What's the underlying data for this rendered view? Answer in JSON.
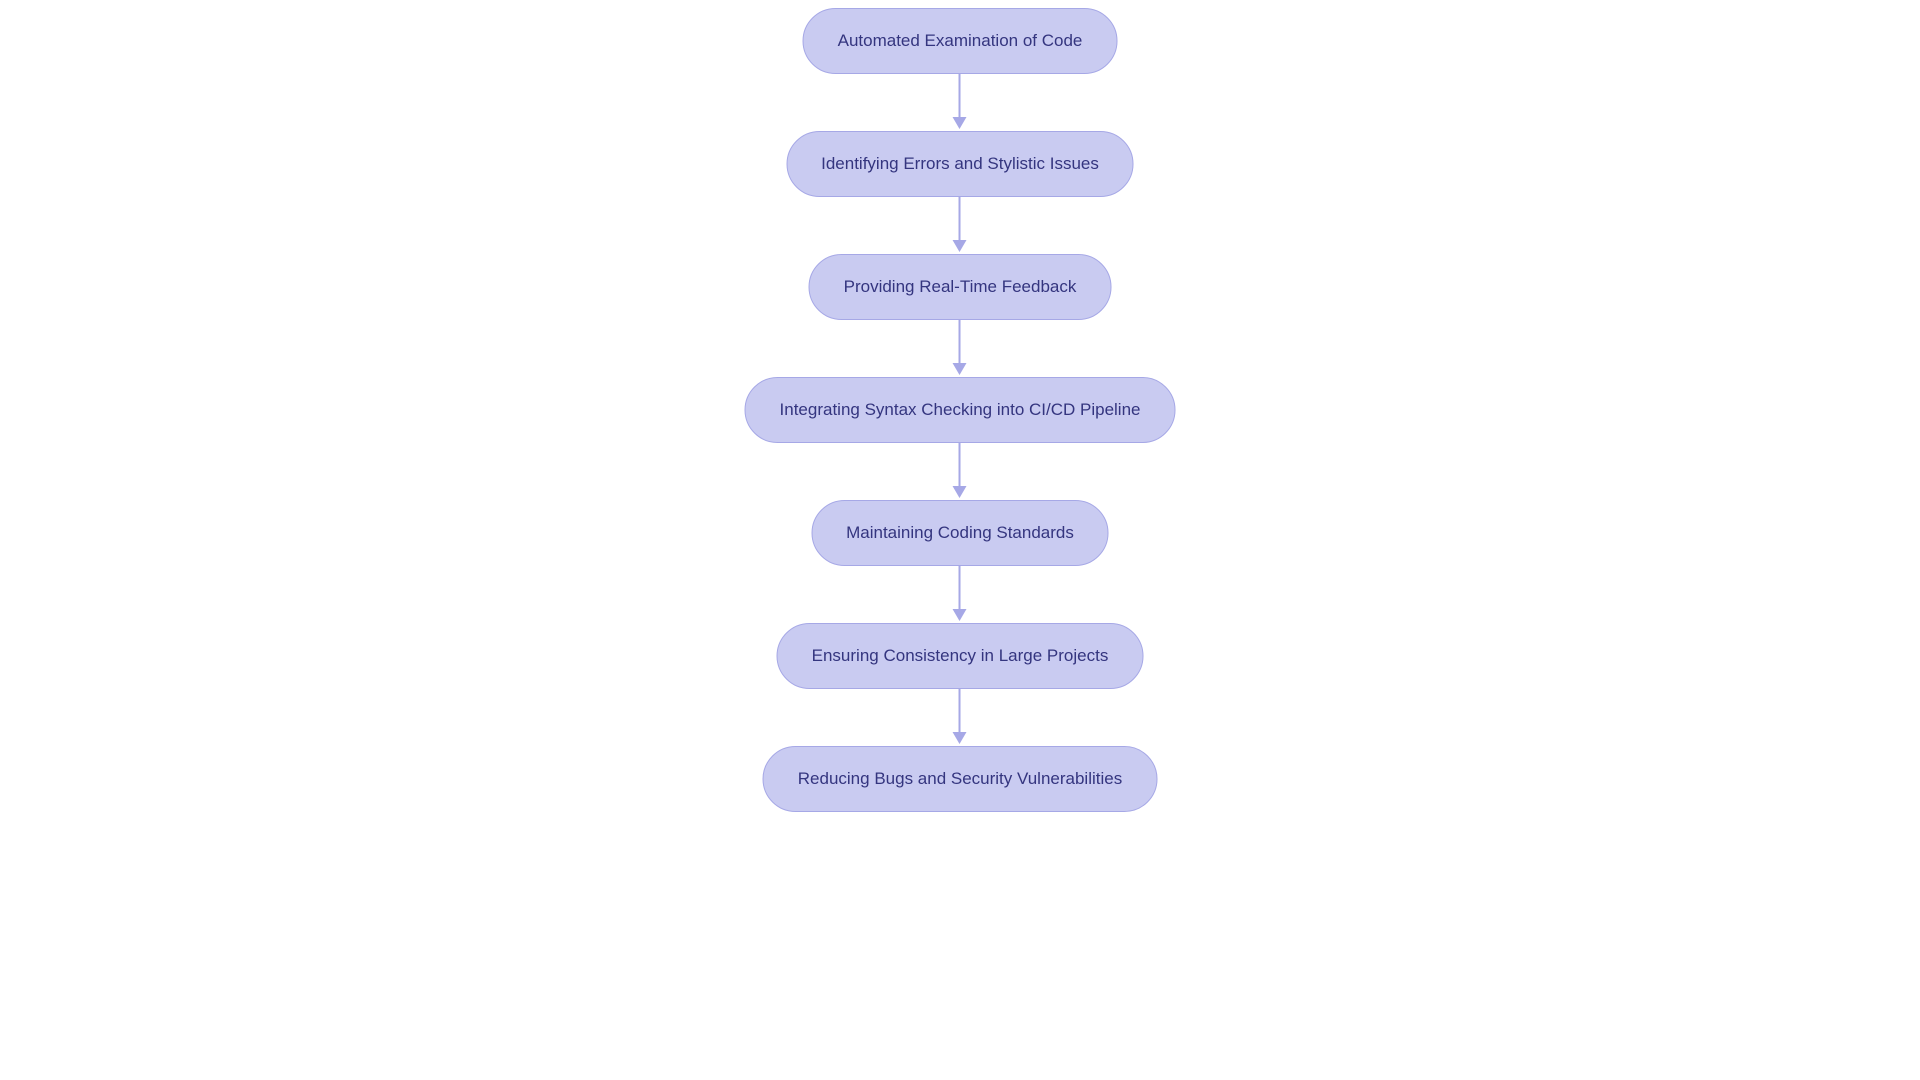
{
  "nodes": [
    {
      "label": "Automated Examination of Code"
    },
    {
      "label": "Identifying Errors and Stylistic Issues"
    },
    {
      "label": "Providing Real-Time Feedback"
    },
    {
      "label": "Integrating Syntax Checking into CI/CD Pipeline"
    },
    {
      "label": "Maintaining Coding Standards"
    },
    {
      "label": "Ensuring Consistency in Large Projects"
    },
    {
      "label": "Reducing Bugs and Security Vulnerabilities"
    }
  ],
  "colors": {
    "node_fill": "#c9cbf1",
    "node_border": "#a6a8e6",
    "node_text": "#34357f",
    "arrow": "#a6a8e6"
  }
}
